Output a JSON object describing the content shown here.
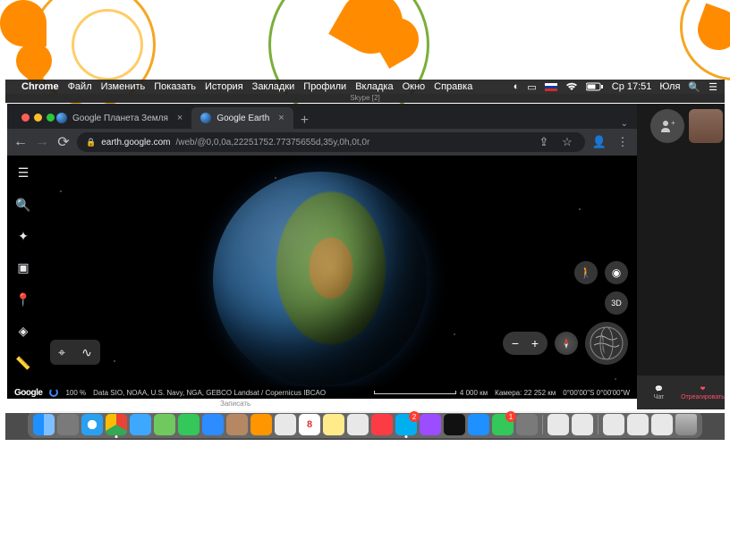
{
  "menubar": {
    "app": "Chrome",
    "items": [
      "Файл",
      "Изменить",
      "Показать",
      "История",
      "Закладки",
      "Профили",
      "Вкладка",
      "Окно",
      "Справка"
    ],
    "battery_pct": "62",
    "clock": "Ср 17:51",
    "user": "Юля"
  },
  "background_window": {
    "title": "Skype [2]"
  },
  "chrome": {
    "tabs": [
      {
        "label": "Google Планета Земля",
        "active": false
      },
      {
        "label": "Google Earth",
        "active": true
      }
    ],
    "url_host": "earth.google.com",
    "url_path": "/web/@0,0,0a,22251752.77375655d,35y,0h,0t,0r"
  },
  "earth": {
    "sidebar_icons": [
      "menu",
      "search",
      "wheel",
      "project",
      "pin",
      "layers",
      "ruler"
    ],
    "chip_icons": [
      "pin",
      "graph"
    ],
    "pegman": "pegman",
    "eye": "eye",
    "mode3d": "3D",
    "zoom_out": "−",
    "zoom_in": "+",
    "compass": "N",
    "logo": "Google",
    "progress": "100 %",
    "attrib": "Data SIO, NOAA, U.S. Navy, NGA, GEBCO   Landsat / Copernicus   IBCAO",
    "scale_label": "4 000 км",
    "camera": "Камера: 22 252 км",
    "coords": "0°00'00\"S 0°00'00\"W"
  },
  "skype": {
    "add_person": "+",
    "chat": "Чат",
    "react": "Отреагировать",
    "record": "Записать"
  },
  "dock": {
    "items": [
      {
        "name": "finder",
        "color": "#1e90ff"
      },
      {
        "name": "launchpad",
        "color": "#7a7a7a"
      },
      {
        "name": "safari",
        "color": "#2aa0f0"
      },
      {
        "name": "chrome",
        "color": "#f4c20d",
        "running": true
      },
      {
        "name": "mail",
        "color": "#3ea8ff"
      },
      {
        "name": "maps",
        "color": "#6fc95e"
      },
      {
        "name": "messages",
        "color": "#34c759"
      },
      {
        "name": "zoom",
        "color": "#2d8cff"
      },
      {
        "name": "contacts",
        "color": "#b58863"
      },
      {
        "name": "photos",
        "color": "#ff9500"
      },
      {
        "name": "reminders",
        "color": "#e8e8e8"
      },
      {
        "name": "calendar",
        "color": "#ffffff",
        "text": "8"
      },
      {
        "name": "notes",
        "color": "#ffeb8a"
      },
      {
        "name": "preview",
        "color": "#e8e8e8"
      },
      {
        "name": "music",
        "color": "#fc3c44"
      },
      {
        "name": "skype",
        "color": "#00aff0",
        "badge": "2",
        "running": true
      },
      {
        "name": "podcasts",
        "color": "#9b4dff"
      },
      {
        "name": "appletv",
        "color": "#111"
      },
      {
        "name": "appstore",
        "color": "#1e90ff"
      },
      {
        "name": "facetime",
        "color": "#34c759",
        "badge": "1"
      },
      {
        "name": "photobooth",
        "color": "#7a7a7a"
      }
    ],
    "right_items": [
      {
        "name": "pages-doc",
        "color": "#e8e8e8"
      },
      {
        "name": "numbers-doc",
        "color": "#e8e8e8"
      }
    ],
    "far_right": [
      {
        "name": "screenshot1",
        "color": "#e8e8e8"
      },
      {
        "name": "screenshot2",
        "color": "#e8e8e8"
      },
      {
        "name": "screenshot3",
        "color": "#e8e8e8"
      },
      {
        "name": "trash",
        "color": "#8a8a8a"
      }
    ]
  }
}
